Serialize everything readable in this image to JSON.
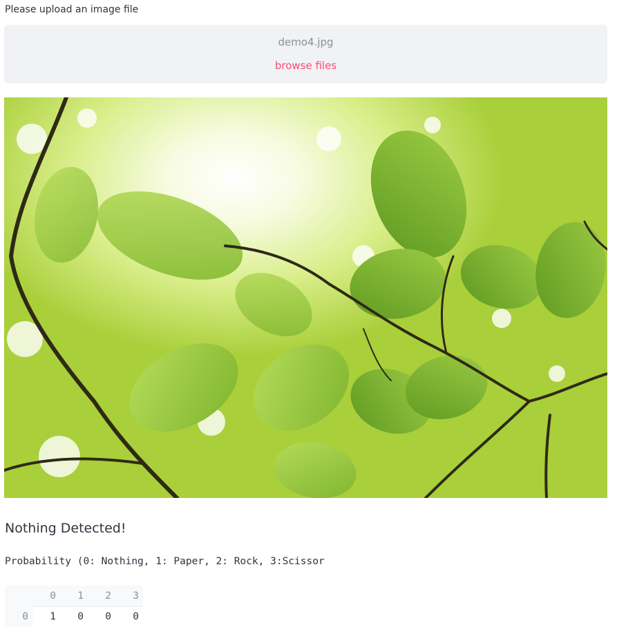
{
  "uploader": {
    "label": "Please upload an image file",
    "filename": "demo4.jpg",
    "browse_label": "browse files"
  },
  "image": {
    "subject": "sunlit green leaves"
  },
  "result": {
    "heading": "Nothing Detected!",
    "probability_caption": "Probability (0: Nothing, 1: Paper, 2: Rock, 3:Scissor"
  },
  "table": {
    "columns": [
      "0",
      "1",
      "2",
      "3"
    ],
    "rows": [
      {
        "index": "0",
        "values": [
          "1",
          "0",
          "0",
          "0"
        ]
      }
    ]
  },
  "colors": {
    "accent": "#ff4b6e",
    "dropzone_bg": "#f0f2f6",
    "text": "#31333f",
    "muted": "#8c8e96"
  }
}
